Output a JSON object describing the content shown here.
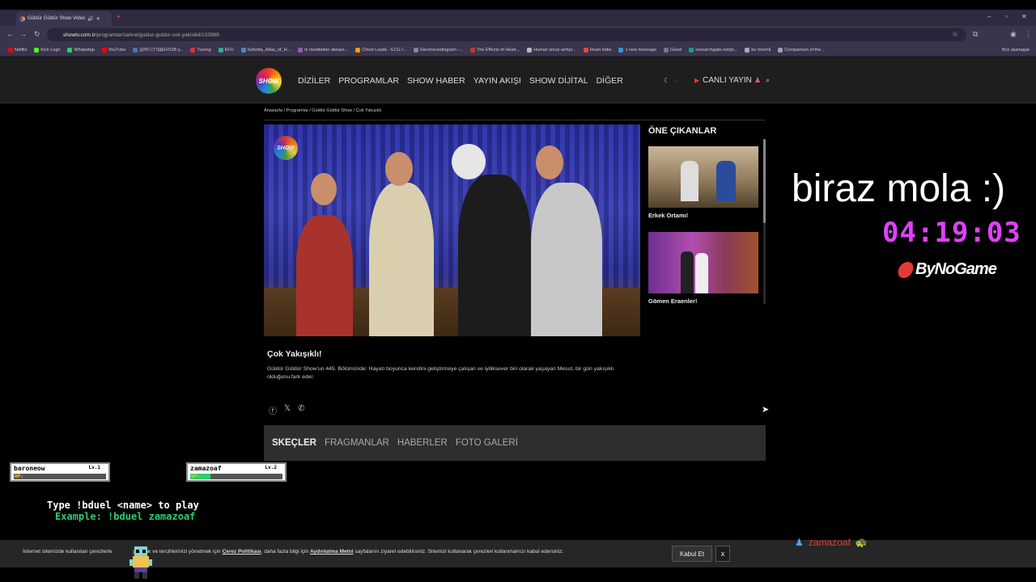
{
  "browser": {
    "tab_title": "Güldür Güldür Show Video",
    "url_domain": "showtv.com.tr",
    "url_path": "/programlar/sahne/guldur-guldur-cok-yakisikli/133969",
    "bookmarks": [
      "Netflix",
      "Kick Logo",
      "WhatsApp",
      "YouTube",
      "ДЛЯ СТУДЕНТОВ у...",
      "Tureng",
      "KFU",
      "Sobotta_Atlas_of_H...",
      "Is meditation always...",
      "Chest Leads - ECG l...",
      "Electrocardiogram -...",
      "The Effects of Heart...",
      "Human sinus arrhyt...",
      "Heart India",
      "1 new message",
      "Güzel",
      "researchgate.net/pr...",
      "bu önemli",
      "Comparison of the..."
    ],
    "bookmarks_other": "Все закладки"
  },
  "site": {
    "logo_text": "SHOW",
    "nav": [
      "DİZİLER",
      "PROGRAMLAR",
      "SHOW HABER",
      "YAYIN AKIŞI",
      "SHOW DİJİTAL",
      "DİĞER"
    ],
    "live_label": "CANLI YAYIN"
  },
  "breadcrumb": "Anasayfa / Programlar / Güldür Güldür Show / Çok Yakışıklı",
  "sidebar": {
    "title": "ÖNE ÇIKANLAR",
    "items": [
      {
        "caption": "Erkek Ortamı!"
      },
      {
        "caption": "Gömen Eraenler!"
      }
    ]
  },
  "episode": {
    "title": "Çok Yakışıklı!",
    "description": "Güldür Güldür Show'un 445. Bölümünde: Hayatı boyunca kendini geliştirmeye çalışan ve iyiliksever biri olarak yaşayan Mesut, bir gün yakışıklı olduğunu fark eder."
  },
  "content_tabs": [
    "SKEÇLER",
    "FRAGMANLAR",
    "HABERLER",
    "FOTO GALERİ"
  ],
  "overlay": {
    "break_text": "biraz mola :)",
    "timer": "04:19:03",
    "brand": "ByNoGame",
    "players": [
      {
        "name": "baroneow",
        "level": "Lv.1",
        "hp_label": "HP:",
        "hp": 0.0
      },
      {
        "name": "zamazoaf",
        "level": "Lv.2",
        "hp_label": "HP:",
        "hp": 0.22
      }
    ],
    "duel_instruction": "Type !bduel <name> to play",
    "duel_example": "Example: !bduel zamazoaf",
    "chat_name": "zamazoaf"
  },
  "cookie": {
    "part1": "İnternet sitemizde kullanılan çerezlerle ",
    "part2": "ji almak ve tercihlerinizi yönetmek için ",
    "link1": "Çerez Politikası",
    "part3": ", daha fazla bilgi için ",
    "link2": "Aydınlatma Metni",
    "part4": " sayfalarını ziyaret edebilirsiniz. Sitemizi kullanarak çerezleri kullanmamızı kabul edersiniz.",
    "accept": "Kabul Et",
    "close": "x"
  }
}
